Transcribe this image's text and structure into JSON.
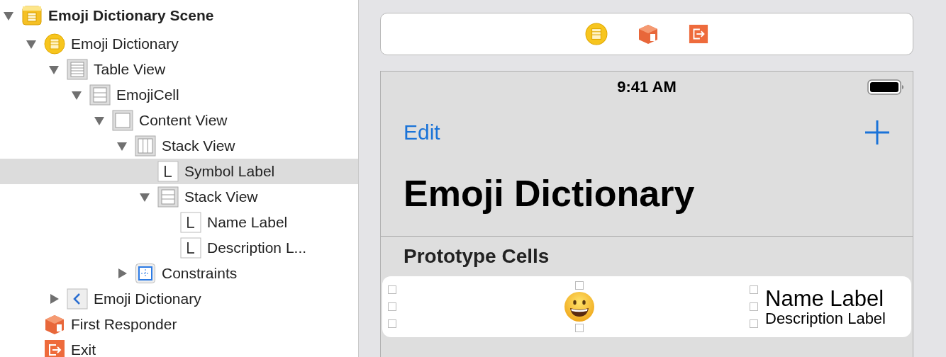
{
  "scene_tree": [
    {
      "label": "Emoji Dictionary Scene",
      "kind": "scene",
      "expanded": true,
      "selected": false,
      "children": [
        {
          "label": "Emoji Dictionary",
          "kind": "controller",
          "expanded": true,
          "selected": false,
          "children": [
            {
              "label": "Table View",
              "kind": "table",
              "expanded": true,
              "selected": false,
              "children": [
                {
                  "label": "EmojiCell",
                  "kind": "cell",
                  "expanded": true,
                  "selected": false,
                  "children": [
                    {
                      "label": "Content View",
                      "kind": "view",
                      "expanded": true,
                      "selected": false,
                      "children": [
                        {
                          "label": "Stack View",
                          "kind": "hstack",
                          "expanded": true,
                          "selected": false,
                          "children": [
                            {
                              "label": "Symbol Label",
                              "kind": "label",
                              "selected": true
                            },
                            {
                              "label": "Stack View",
                              "kind": "vstack",
                              "expanded": true,
                              "selected": false,
                              "children": [
                                {
                                  "label": "Name Label",
                                  "kind": "label",
                                  "selected": false
                                },
                                {
                                  "label": "Description L...",
                                  "kind": "label",
                                  "selected": false
                                }
                              ]
                            }
                          ]
                        },
                        {
                          "label": "Constraints",
                          "kind": "constraints",
                          "expanded": false,
                          "selected": false
                        }
                      ]
                    }
                  ]
                }
              ]
            },
            {
              "label": "Emoji Dictionary",
              "kind": "navitem",
              "expanded": false,
              "selected": false
            }
          ]
        },
        {
          "label": "First Responder",
          "kind": "responder",
          "selected": false
        },
        {
          "label": "Exit",
          "kind": "exit",
          "selected": false
        }
      ]
    }
  ],
  "phone": {
    "status_bar": {
      "time": "9:41 AM"
    },
    "nav_bar": {
      "left_button": "Edit"
    },
    "large_title": "Emoji Dictionary",
    "section_header": "Prototype Cells",
    "cell": {
      "name_label": "Name Label",
      "description_label": "Description Label"
    }
  }
}
